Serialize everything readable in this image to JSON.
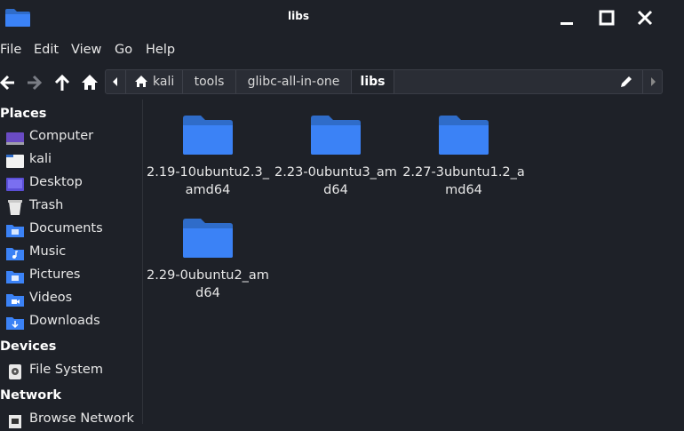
{
  "window": {
    "title": "libs"
  },
  "menubar": {
    "items": [
      "File",
      "Edit",
      "View",
      "Go",
      "Help"
    ]
  },
  "path": {
    "crumbs": [
      "kali",
      "tools",
      "glibc-all-in-one",
      "libs"
    ]
  },
  "sidebar": {
    "sections": [
      {
        "title": "Places",
        "items": [
          {
            "label": "Computer",
            "icon": "computer-icon"
          },
          {
            "label": "kali",
            "icon": "home-folder-icon"
          },
          {
            "label": "Desktop",
            "icon": "desktop-icon"
          },
          {
            "label": "Trash",
            "icon": "trash-icon"
          },
          {
            "label": "Documents",
            "icon": "documents-folder-icon"
          },
          {
            "label": "Music",
            "icon": "music-folder-icon"
          },
          {
            "label": "Pictures",
            "icon": "pictures-folder-icon"
          },
          {
            "label": "Videos",
            "icon": "videos-folder-icon"
          },
          {
            "label": "Downloads",
            "icon": "downloads-folder-icon"
          }
        ]
      },
      {
        "title": "Devices",
        "items": [
          {
            "label": "File System",
            "icon": "drive-icon"
          }
        ]
      },
      {
        "title": "Network",
        "items": [
          {
            "label": "Browse Network",
            "icon": "network-icon"
          }
        ]
      }
    ]
  },
  "files": [
    {
      "name": "2.19-10ubuntu2.3_amd64"
    },
    {
      "name": "2.23-0ubuntu3_amd64"
    },
    {
      "name": "2.27-3ubuntu1.2_amd64"
    },
    {
      "name": "2.29-0ubuntu2_amd64"
    }
  ],
  "colors": {
    "folder": "#3a7bd5",
    "background": "#1e2128",
    "accent": "#3b82f6"
  }
}
